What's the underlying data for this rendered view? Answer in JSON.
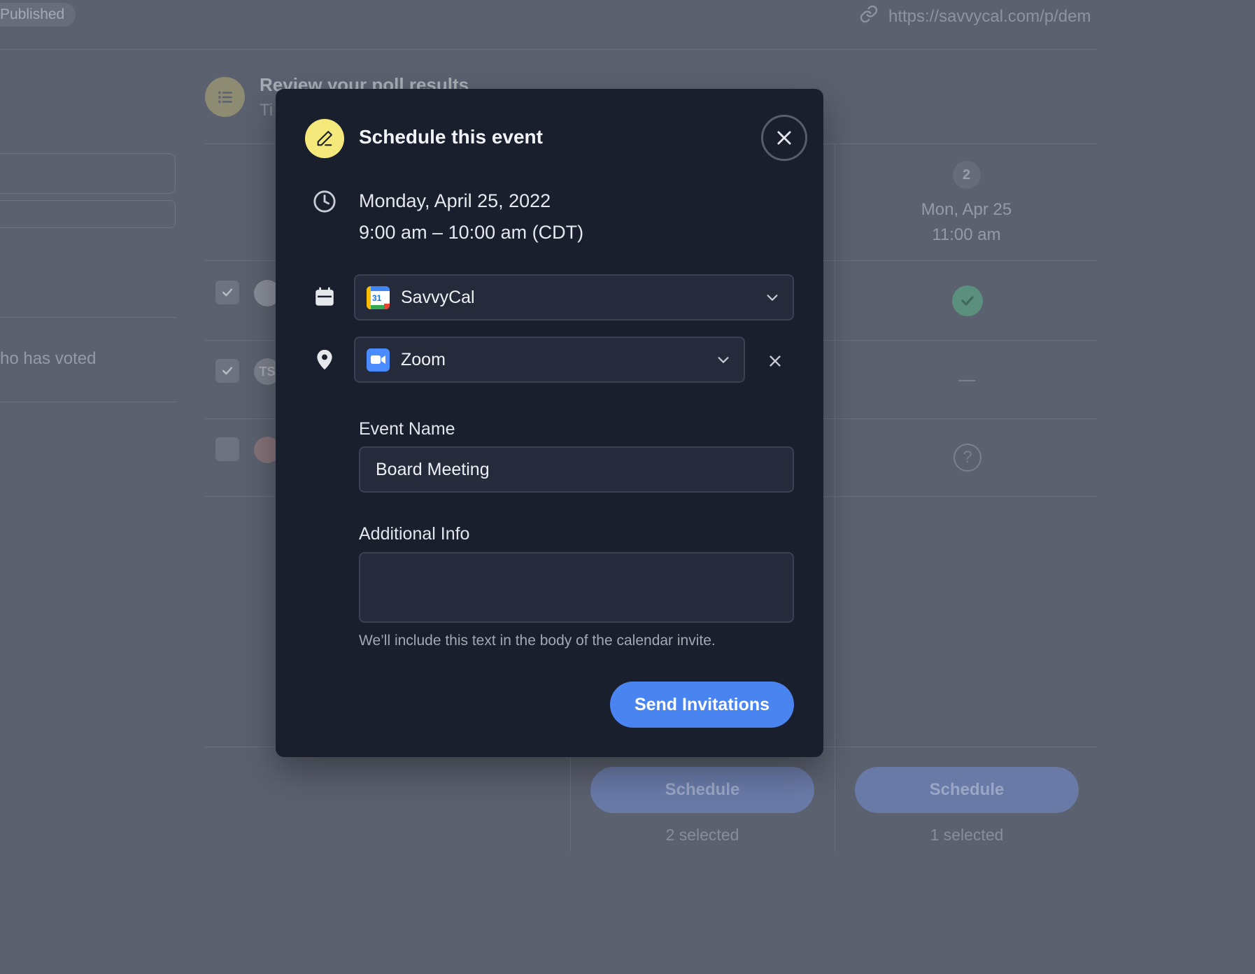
{
  "app": {
    "status_badge": "Published",
    "share_url": "https://savvycal.com/p/dem"
  },
  "background": {
    "poll_title": "Review your poll results",
    "poll_subtitle": "Ti",
    "voted_text": "ho has voted",
    "participants": [
      {
        "checked": true,
        "avatar_initials": ""
      },
      {
        "checked": true,
        "avatar_initials": "TS"
      },
      {
        "checked": false,
        "avatar_initials": ""
      }
    ],
    "column_2": {
      "number": "2",
      "date": "Mon, Apr 25",
      "time": "11:00 am",
      "votes": [
        "yes",
        "none",
        "maybe"
      ],
      "maybe_symbol": "?"
    },
    "schedule_buttons": [
      {
        "label": "Schedule",
        "selected_text": "2 selected"
      },
      {
        "label": "Schedule",
        "selected_text": "1 selected"
      }
    ]
  },
  "modal": {
    "title": "Schedule this event",
    "date": "Monday, April 25, 2022",
    "time": "9:00 am – 10:00 am (CDT)",
    "calendar_select": {
      "value": "SavvyCal",
      "icon": "google-calendar-icon",
      "icon_number": "31"
    },
    "location_select": {
      "value": "Zoom",
      "icon": "zoom-icon"
    },
    "event_name_label": "Event Name",
    "event_name_value": "Board Meeting",
    "additional_info_label": "Additional Info",
    "additional_info_value": "",
    "additional_info_hint": "We’ll include this text in the body of the calendar invite.",
    "send_button": "Send Invitations"
  },
  "colors": {
    "accent": "#4a84f0",
    "modal_bg": "#1a1f2e",
    "title_icon_bg": "#f6e97b",
    "overlay_bg": "#5c6170"
  }
}
